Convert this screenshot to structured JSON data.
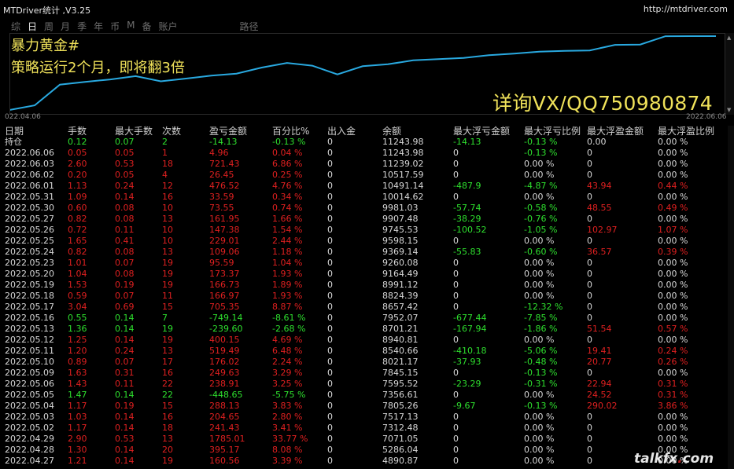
{
  "window": {
    "title": "MTDriver统计 ,V3.25",
    "link": "http://mtdriver.com"
  },
  "tabs": [
    {
      "label": "综",
      "active": false
    },
    {
      "label": "日",
      "active": true
    },
    {
      "label": "周",
      "active": false
    },
    {
      "label": "月",
      "active": false
    },
    {
      "label": "季",
      "active": false
    },
    {
      "label": "年",
      "active": false
    },
    {
      "label": "币",
      "active": false
    },
    {
      "label": "M",
      "active": false
    },
    {
      "label": "备",
      "active": false
    },
    {
      "label": "账户",
      "active": false
    },
    {
      "label": "路径",
      "active": false
    }
  ],
  "overlay": {
    "line1": "暴力黄金#",
    "line2": "策略运行2个月，即将翻3倍",
    "contact": "详询VX/QQ750980874"
  },
  "chart_data": {
    "type": "line",
    "x_start": "022.04.06",
    "x_end": "2022.06.06",
    "color": "#29a9e0",
    "values": [
      4890,
      5286,
      7071,
      7312,
      7517,
      7805,
      7356,
      7595,
      7845,
      8021,
      8540,
      8940,
      8701,
      7952,
      8657,
      8824,
      9164,
      9260,
      9369,
      9598,
      9745,
      9907,
      9981,
      10014,
      10491,
      10517,
      11239,
      11243,
      11243
    ]
  },
  "columns": [
    "日期",
    "手数",
    "最大手数",
    "次数",
    "盈亏金额",
    "百分比%",
    "出入金",
    "余额",
    "最大浮亏金额",
    "最大浮亏比例",
    "最大浮盈金额",
    "最大浮盈比例"
  ],
  "rows": [
    {
      "c": [
        "持仓",
        "0.12",
        "0.07",
        "2",
        "-14.13",
        "-0.13 %",
        "0",
        "11243.98",
        "-14.13",
        "-0.13 %",
        "0.00",
        "0.00 %"
      ],
      "t": "hold"
    },
    {
      "c": [
        "2022.06.06",
        "0.05",
        "0.05",
        "1",
        "4.96",
        "0.04 %",
        "0",
        "11243.98",
        "0",
        "-0.13 %",
        "0",
        "0.00 %"
      ],
      "t": "pos"
    },
    {
      "c": [
        "2022.06.03",
        "2.60",
        "0.53",
        "18",
        "721.43",
        "6.86 %",
        "0",
        "11239.02",
        "0",
        "0.00 %",
        "0",
        "0.00 %"
      ],
      "t": "pos"
    },
    {
      "c": [
        "2022.06.02",
        "0.20",
        "0.05",
        "4",
        "26.45",
        "0.25 %",
        "0",
        "10517.59",
        "0",
        "0.00 %",
        "0",
        "0.00 %"
      ],
      "t": "pos"
    },
    {
      "c": [
        "2022.06.01",
        "1.13",
        "0.24",
        "12",
        "476.52",
        "4.76 %",
        "0",
        "10491.14",
        "-487.9",
        "-4.87 %",
        "43.94",
        "0.44 %"
      ],
      "t": "pos"
    },
    {
      "c": [
        "2022.05.31",
        "1.09",
        "0.14",
        "16",
        "33.59",
        "0.34 %",
        "0",
        "10014.62",
        "0",
        "0.00 %",
        "0",
        "0.00 %"
      ],
      "t": "pos"
    },
    {
      "c": [
        "2022.05.30",
        "0.60",
        "0.08",
        "10",
        "73.55",
        "0.74 %",
        "0",
        "9981.03",
        "-57.74",
        "-0.58 %",
        "48.55",
        "0.49 %"
      ],
      "t": "pos"
    },
    {
      "c": [
        "2022.05.27",
        "0.82",
        "0.08",
        "13",
        "161.95",
        "1.66 %",
        "0",
        "9907.48",
        "-38.29",
        "-0.76 %",
        "0",
        "0.00 %"
      ],
      "t": "pos"
    },
    {
      "c": [
        "2022.05.26",
        "0.72",
        "0.11",
        "10",
        "147.38",
        "1.54 %",
        "0",
        "9745.53",
        "-100.52",
        "-1.05 %",
        "102.97",
        "1.07 %"
      ],
      "t": "pos"
    },
    {
      "c": [
        "2022.05.25",
        "1.65",
        "0.41",
        "10",
        "229.01",
        "2.44 %",
        "0",
        "9598.15",
        "0",
        "0.00 %",
        "0",
        "0.00 %"
      ],
      "t": "pos"
    },
    {
      "c": [
        "2022.05.24",
        "0.82",
        "0.08",
        "13",
        "109.06",
        "1.18 %",
        "0",
        "9369.14",
        "-55.83",
        "-0.60 %",
        "36.57",
        "0.39 %"
      ],
      "t": "pos"
    },
    {
      "c": [
        "2022.05.23",
        "1.01",
        "0.07",
        "19",
        "95.59",
        "1.04 %",
        "0",
        "9260.08",
        "0",
        "0.00 %",
        "0",
        "0.00 %"
      ],
      "t": "pos"
    },
    {
      "c": [
        "2022.05.20",
        "1.04",
        "0.08",
        "19",
        "173.37",
        "1.93 %",
        "0",
        "9164.49",
        "0",
        "0.00 %",
        "0",
        "0.00 %"
      ],
      "t": "pos"
    },
    {
      "c": [
        "2022.05.19",
        "1.53",
        "0.19",
        "19",
        "166.73",
        "1.89 %",
        "0",
        "8991.12",
        "0",
        "0.00 %",
        "0",
        "0.00 %"
      ],
      "t": "pos"
    },
    {
      "c": [
        "2022.05.18",
        "0.59",
        "0.07",
        "11",
        "166.97",
        "1.93 %",
        "0",
        "8824.39",
        "0",
        "0.00 %",
        "0",
        "0.00 %"
      ],
      "t": "pos"
    },
    {
      "c": [
        "2022.05.17",
        "3.04",
        "0.69",
        "15",
        "705.35",
        "8.87 %",
        "0",
        "8657.42",
        "0",
        "-12.32 %",
        "0",
        "0.00 %"
      ],
      "t": "pos"
    },
    {
      "c": [
        "2022.05.16",
        "0.55",
        "0.14",
        "7",
        "-749.14",
        "-8.61 %",
        "0",
        "7952.07",
        "-677.44",
        "-7.85 %",
        "0",
        "0.00 %"
      ],
      "t": "neg"
    },
    {
      "c": [
        "2022.05.13",
        "1.36",
        "0.14",
        "19",
        "-239.60",
        "-2.68 %",
        "0",
        "8701.21",
        "-167.94",
        "-1.86 %",
        "51.54",
        "0.57 %"
      ],
      "t": "neg"
    },
    {
      "c": [
        "2022.05.12",
        "1.25",
        "0.14",
        "19",
        "400.15",
        "4.69 %",
        "0",
        "8940.81",
        "0",
        "0.00 %",
        "0",
        "0.00 %"
      ],
      "t": "pos"
    },
    {
      "c": [
        "2022.05.11",
        "1.20",
        "0.24",
        "13",
        "519.49",
        "6.48 %",
        "0",
        "8540.66",
        "-410.18",
        "-5.06 %",
        "19.41",
        "0.24 %"
      ],
      "t": "pos"
    },
    {
      "c": [
        "2022.05.10",
        "0.89",
        "0.07",
        "17",
        "176.02",
        "2.24 %",
        "0",
        "8021.17",
        "-37.93",
        "-0.48 %",
        "20.77",
        "0.26 %"
      ],
      "t": "pos"
    },
    {
      "c": [
        "2022.05.09",
        "1.63",
        "0.31",
        "16",
        "249.63",
        "3.29 %",
        "0",
        "7845.15",
        "0",
        "-0.13 %",
        "0",
        "0.00 %"
      ],
      "t": "pos"
    },
    {
      "c": [
        "2022.05.06",
        "1.43",
        "0.11",
        "22",
        "238.91",
        "3.25 %",
        "0",
        "7595.52",
        "-23.29",
        "-0.31 %",
        "22.94",
        "0.31 %"
      ],
      "t": "pos"
    },
    {
      "c": [
        "2022.05.05",
        "1.47",
        "0.14",
        "22",
        "-448.65",
        "-5.75 %",
        "0",
        "7356.61",
        "0",
        "0.00 %",
        "24.52",
        "0.31 %"
      ],
      "t": "neg"
    },
    {
      "c": [
        "2022.05.04",
        "1.17",
        "0.19",
        "15",
        "288.13",
        "3.83 %",
        "0",
        "7805.26",
        "-9.67",
        "-0.13 %",
        "290.02",
        "3.86 %"
      ],
      "t": "pos"
    },
    {
      "c": [
        "2022.05.03",
        "1.03",
        "0.14",
        "16",
        "204.65",
        "2.80 %",
        "0",
        "7517.13",
        "0",
        "0.00 %",
        "0",
        "0.00 %"
      ],
      "t": "pos"
    },
    {
      "c": [
        "2022.05.02",
        "1.17",
        "0.14",
        "18",
        "241.43",
        "3.41 %",
        "0",
        "7312.48",
        "0",
        "0.00 %",
        "0",
        "0.00 %"
      ],
      "t": "pos"
    },
    {
      "c": [
        "2022.04.29",
        "2.90",
        "0.53",
        "13",
        "1785.01",
        "33.77 %",
        "0",
        "7071.05",
        "0",
        "0.00 %",
        "0",
        "0.00 %"
      ],
      "t": "pos"
    },
    {
      "c": [
        "2022.04.28",
        "1.30",
        "0.14",
        "20",
        "395.17",
        "8.08 %",
        "0",
        "5286.04",
        "0",
        "0.00 %",
        "0",
        "0.00 %"
      ],
      "t": "pos"
    },
    {
      "c": [
        "2022.04.27",
        "1.21",
        "0.14",
        "19",
        "160.56",
        "3.39 %",
        "0",
        "4890.87",
        "0",
        "0.00 %",
        "0",
        "0.00 %"
      ],
      "t": "pos"
    }
  ],
  "watermark": {
    "pre": "talkfx",
    "dot": ".",
    "post": "com"
  }
}
